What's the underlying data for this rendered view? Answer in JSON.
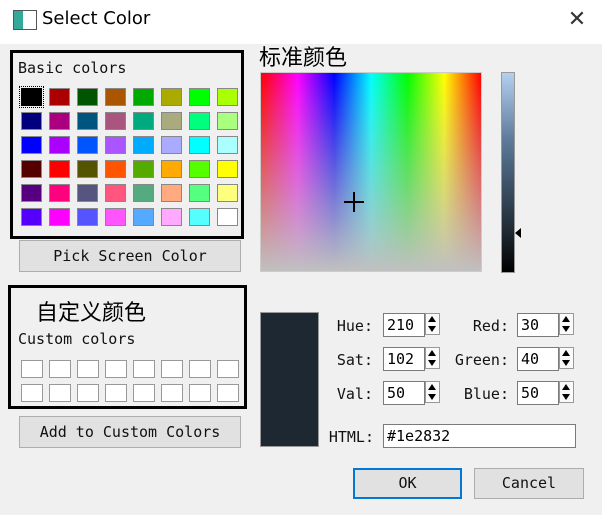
{
  "window": {
    "title": "Select Color",
    "close_glyph": "✕"
  },
  "basic": {
    "label": "Basic colors",
    "colors": [
      "#000000",
      "#aa0000",
      "#005500",
      "#aa5500",
      "#00aa00",
      "#aaaa00",
      "#00ff00",
      "#aaff00",
      "#00007f",
      "#aa007f",
      "#00557f",
      "#aa557f",
      "#00aa7f",
      "#aaaa7f",
      "#00ff7f",
      "#aaff7f",
      "#0000ff",
      "#aa00ff",
      "#0055ff",
      "#aa55ff",
      "#00aaff",
      "#aaaaff",
      "#00ffff",
      "#aaffff",
      "#550000",
      "#ff0000",
      "#555500",
      "#ff5500",
      "#55aa00",
      "#ffaa00",
      "#55ff00",
      "#ffff00",
      "#55007f",
      "#ff007f",
      "#55557f",
      "#ff557f",
      "#55aa7f",
      "#ffaa7f",
      "#55ff7f",
      "#ffff7f",
      "#5500ff",
      "#ff00ff",
      "#5555ff",
      "#ff55ff",
      "#55aaff",
      "#ffaaff",
      "#55ffff",
      "#ffffff"
    ],
    "selected_index": 0
  },
  "pick_screen_label": "Pick Screen Color",
  "custom": {
    "heading": "自定义颜色",
    "label": "Custom colors",
    "count": 16
  },
  "add_custom_label": "Add to Custom Colors",
  "spectrum": {
    "heading": "标准颜色"
  },
  "current_color": "#1e2832",
  "fields": {
    "hue": {
      "label": "Hue:",
      "value": "210"
    },
    "sat": {
      "label": "Sat:",
      "value": "102"
    },
    "val": {
      "label": "Val:",
      "value": "50"
    },
    "red": {
      "label": "Red:",
      "value": "30"
    },
    "green": {
      "label": "Green:",
      "value": "40"
    },
    "blue": {
      "label": "Blue:",
      "value": "50"
    },
    "html": {
      "label": "HTML:",
      "value": "#1e2832"
    }
  },
  "buttons": {
    "ok": "OK",
    "cancel": "Cancel"
  }
}
